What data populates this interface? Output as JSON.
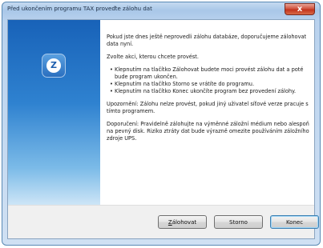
{
  "window": {
    "title": "Před ukončením programu TAX proveďte zálohu dat",
    "close_glyph": "x"
  },
  "logo": {
    "glyph": "Z",
    "icon": "tax-logo-icon"
  },
  "message": {
    "intro": "Pokud jste dnes ještě neprovedli zálohu databáze, doporučujeme zálohovat data nyní.",
    "choose": "Zvolte akci, kterou chcete provést.",
    "bullets": [
      "Klepnutím na tlačítko Zálohovat budete moci provést zálohu dat a poté bude program ukončen.",
      "Klepnutím na tlačítko Storno se vrátíte do programu.",
      "Klepnutím na tlačítko Konec ukončíte program bez provedení zálohy."
    ],
    "warning": "Upozornění: Zálohu nelze provést, pokud jiný uživatel síťové verze pracuje s tímto programem.",
    "advice": "Doporučení: Pravidelně zálohujte na výměnné záložní médium nebo alespoň na pevný disk. Riziko ztráty dat bude výrazně omezite používáním záložního zdroje UPS."
  },
  "buttons": {
    "save_first": "Z",
    "save_rest": "álohovat",
    "cancel": "Storno",
    "end": "Konec"
  },
  "colors": {
    "side_panel_top": "#1862b8",
    "side_panel_bottom": "#cfe6f7",
    "close_button": "#c2331d"
  }
}
